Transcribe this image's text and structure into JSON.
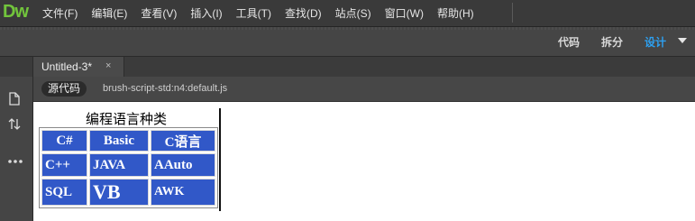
{
  "app": {
    "logo": "Dw",
    "menu": [
      "文件(F)",
      "编辑(E)",
      "查看(V)",
      "插入(I)",
      "工具(T)",
      "查找(D)",
      "站点(S)",
      "窗口(W)",
      "帮助(H)"
    ]
  },
  "viewbar": {
    "code": "代码",
    "split": "拆分",
    "design": "设计"
  },
  "tab": {
    "title": "Untitled-3*",
    "close": "×"
  },
  "related": {
    "source": "源代码",
    "file": "brush-script-std:n4:default.js"
  },
  "design": {
    "caption": "编程语言种类",
    "headers": [
      "C#",
      "Basic",
      "C语言"
    ],
    "rows": [
      [
        "C++",
        "JAVA",
        "AAuto"
      ],
      [
        "SQL",
        "VB",
        "AWK"
      ]
    ]
  },
  "colors": {
    "cell_bg": "#3158c8",
    "accent": "#2da0f0",
    "logo": "#72c53c"
  }
}
